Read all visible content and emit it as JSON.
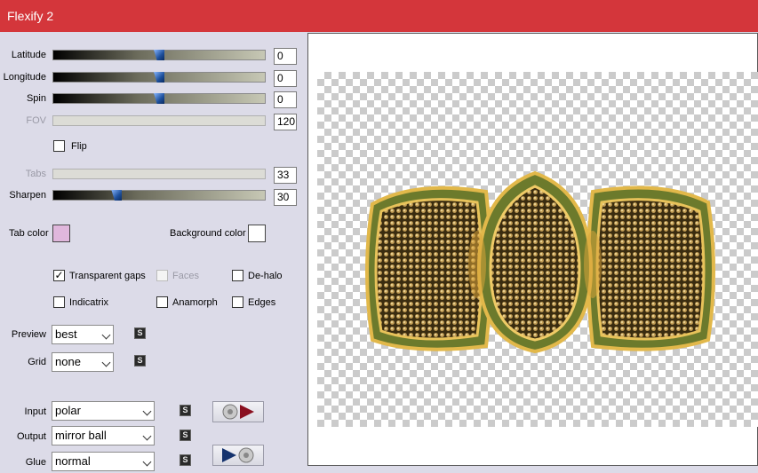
{
  "window": {
    "title": "Flexify 2"
  },
  "sliders": {
    "latitude": {
      "label": "Latitude",
      "value": "0",
      "fraction": 0.5
    },
    "longitude": {
      "label": "Longitude",
      "value": "0",
      "fraction": 0.5
    },
    "spin": {
      "label": "Spin",
      "value": "0",
      "fraction": 0.5
    },
    "fov": {
      "label": "FOV",
      "value": "120"
    },
    "tabs": {
      "label": "Tabs",
      "value": "33"
    },
    "sharpen": {
      "label": "Sharpen",
      "value": "30",
      "fraction": 0.3
    }
  },
  "flip": {
    "label": "Flip",
    "checked": false
  },
  "colors": {
    "tab_label": "Tab color",
    "tab_color": "#e0b7dc",
    "background_label": "Background color",
    "background_color": "#ffffff"
  },
  "options": {
    "transparent_gaps": {
      "label": "Transparent gaps",
      "checked": true,
      "mark": "✓"
    },
    "faces": {
      "label": "Faces",
      "checked": false
    },
    "de_halo": {
      "label": "De-halo",
      "checked": false
    },
    "indicatrix": {
      "label": "Indicatrix",
      "checked": false
    },
    "anamorph": {
      "label": "Anamorph",
      "checked": false
    },
    "edges": {
      "label": "Edges",
      "checked": false
    }
  },
  "dropdowns": {
    "preview": {
      "label": "Preview",
      "value": "best"
    },
    "grid": {
      "label": "Grid",
      "value": "none"
    },
    "input": {
      "label": "Input",
      "value": "polar"
    },
    "output": {
      "label": "Output",
      "value": "mirror ball"
    },
    "glue": {
      "label": "Glue",
      "value": "normal"
    }
  },
  "swap_glyph": "S",
  "icons": {
    "cycle_input": "disc-to-red-arrow-icon",
    "cycle_output": "blue-arrow-to-disc-icon"
  }
}
